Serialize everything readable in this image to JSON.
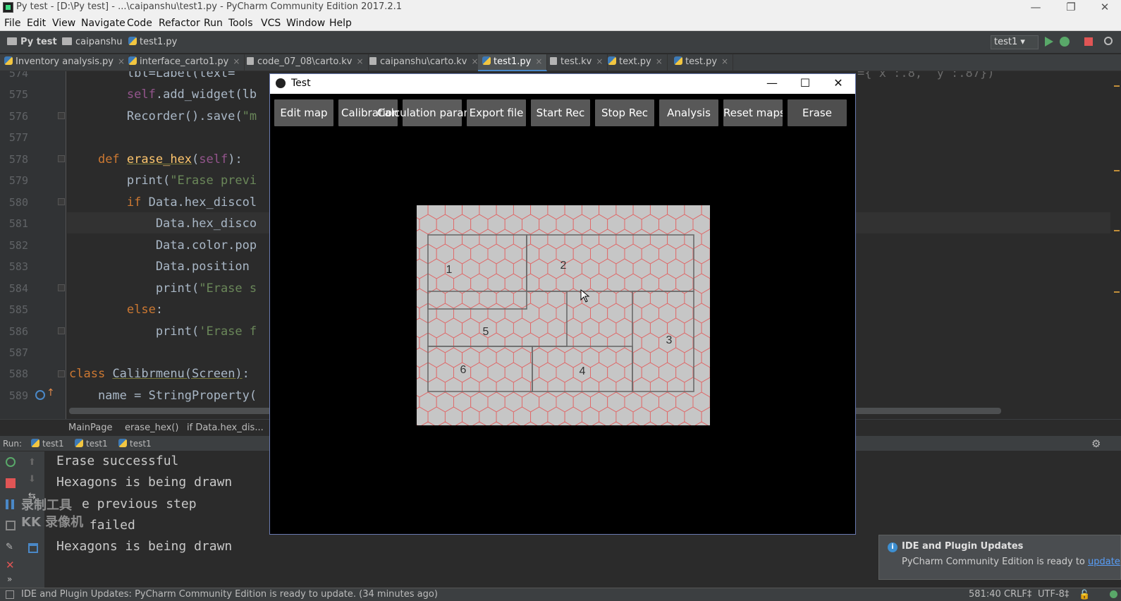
{
  "window_title": "Py test - [D:\\Py test] - ...\\caipanshu\\test1.py - PyCharm Community Edition 2017.2.1",
  "menu": [
    "File",
    "Edit",
    "View",
    "Navigate",
    "Code",
    "Refactor",
    "Run",
    "Tools",
    "VCS",
    "Window",
    "Help"
  ],
  "nav": {
    "project": "Py test",
    "folder": "caipanshu",
    "file": "test1.py",
    "run_config": "test1"
  },
  "tabs": [
    {
      "label": "Inventory analysis.py"
    },
    {
      "label": "interface_carto1.py"
    },
    {
      "label": "code_07_08\\carto.kv"
    },
    {
      "label": "caipanshu\\carto.kv"
    },
    {
      "label": "test1.py"
    },
    {
      "label": "test.kv"
    },
    {
      "label": "text.py"
    },
    {
      "label": "test.py"
    }
  ],
  "editor": {
    "line_numbers": [
      "574",
      "575",
      "576",
      "577",
      "578",
      "579",
      "580",
      "581",
      "582",
      "583",
      "584",
      "585",
      "586",
      "587",
      "588",
      "589"
    ],
    "partial_right_text": "={ x :.8,  y :.87})"
  },
  "breadcrumbs": [
    "MainPage",
    "erase_hex()",
    "if Data.hex_dis..."
  ],
  "run_panel": {
    "label": "Run:",
    "tabs": [
      "test1",
      "test1",
      "test1"
    ],
    "console": [
      "Erase successful",
      "Hexagons is being drawn",
      "e previous step",
      " failed",
      "Hexagons is being drawn"
    ],
    "watermark_line1": "录制工具",
    "watermark_line2": "KK 录像机"
  },
  "status_bar": {
    "message": "IDE and Plugin Updates: PyCharm Community Edition is ready to update. (34 minutes ago)",
    "position": "581:40",
    "line_sep": "CRLF‡",
    "encoding": "UTF-8‡"
  },
  "notification": {
    "title": "IDE and Plugin Updates",
    "body": "PyCharm Community Edition is ready to ",
    "link": "update",
    "period": "."
  },
  "kivy_window": {
    "title": "Test",
    "buttons": [
      "Edit map",
      "Calibration",
      "Calculation param",
      "Export file",
      "Start Rec",
      "Stop Rec",
      "Analysis",
      "Reset maps",
      "Erase"
    ],
    "zone_labels": [
      "1",
      "2",
      "3",
      "4",
      "5",
      "6"
    ]
  },
  "colors": {
    "hex_fill": "#c6c6c6",
    "hex_stroke": "#e06666",
    "zone_stroke": "#6a6a6a",
    "button_bg": "#585858"
  }
}
